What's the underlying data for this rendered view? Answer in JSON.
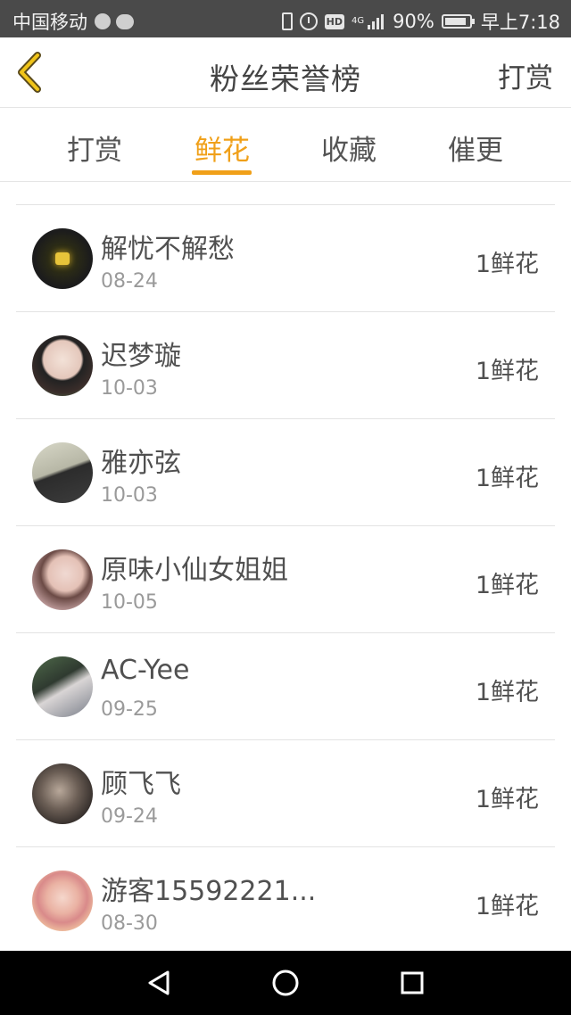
{
  "status_bar": {
    "carrier": "中国移动",
    "network": "4G",
    "hd": "HD",
    "battery_text": "90%",
    "battery_level": 0.9,
    "time": "早上7:18"
  },
  "header": {
    "title": "粉丝荣誉榜",
    "action_label": "打赏",
    "back_icon": "chevron-left-icon",
    "accent_color": "#f0a019"
  },
  "tabs": [
    {
      "label": "打赏",
      "active": false
    },
    {
      "label": "鲜花",
      "active": true
    },
    {
      "label": "收藏",
      "active": false
    },
    {
      "label": "催更",
      "active": false
    }
  ],
  "list": {
    "items": [
      {
        "name": "解忧不解愁",
        "date": "08-24",
        "amount": "1鲜花"
      },
      {
        "name": "迟梦璇",
        "date": "10-03",
        "amount": "1鲜花"
      },
      {
        "name": "雅亦弦",
        "date": "10-03",
        "amount": "1鲜花"
      },
      {
        "name": "原味小仙女姐姐",
        "date": "10-05",
        "amount": "1鲜花"
      },
      {
        "name": "AC-Yee",
        "date": "09-25",
        "amount": "1鲜花"
      },
      {
        "name": "顾飞飞",
        "date": "09-24",
        "amount": "1鲜花"
      },
      {
        "name": "游客15592221...",
        "date": "08-30",
        "amount": "1鲜花"
      }
    ]
  },
  "nav_bar": {
    "back": "triangle-back-icon",
    "home": "circle-home-icon",
    "recents": "square-recents-icon"
  }
}
